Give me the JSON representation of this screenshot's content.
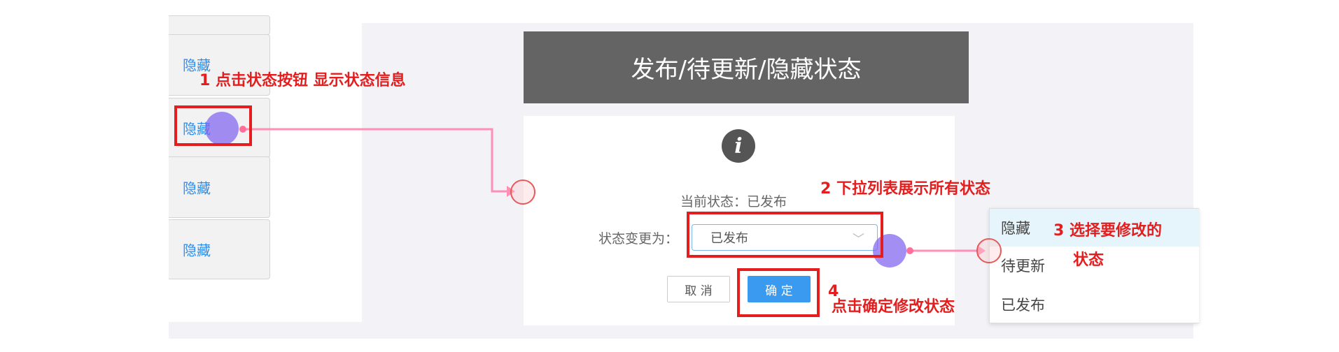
{
  "status_list": {
    "items": [
      "隐藏",
      "隐藏",
      "隐藏",
      "隐藏"
    ]
  },
  "dialog": {
    "title": "发布/待更新/隐藏状态",
    "current_status_text": "当前状态：已发布",
    "change_label": "状态变更为：",
    "select_value": "已发布",
    "cancel_label": "取 消",
    "confirm_label": "确 定"
  },
  "dropdown": {
    "options": [
      "隐藏",
      "待更新",
      "已发布"
    ]
  },
  "annotations": {
    "step1": "1  点击状态按钮 显示状态信息",
    "step2": "2   下拉列表展示所有状态",
    "step3_line1": "3  选择要修改的",
    "step3_line2": "状态",
    "step4_num": "4",
    "step4_text": "点击确定修改状态"
  },
  "colors": {
    "accent": "#3a9af0",
    "annotation_red": "#e41e1e",
    "title_bar": "#646464",
    "connector_pink": "#ff8fb4"
  }
}
